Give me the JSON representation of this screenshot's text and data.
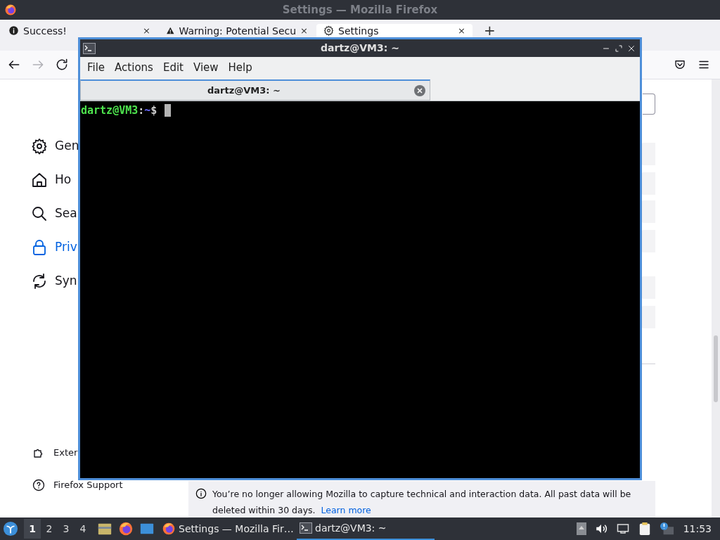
{
  "firefox": {
    "title": "Settings — Mozilla Firefox",
    "tabs": [
      {
        "label": "Success!",
        "close": "×",
        "selected": false
      },
      {
        "label": "Warning: Potential Secu",
        "close": "×",
        "selected": false
      },
      {
        "label": "Settings",
        "close": "×",
        "selected": true
      }
    ],
    "new_tab": "+",
    "nav_buttons": [
      {
        "kind": "back",
        "disabled": false
      },
      {
        "kind": "forward",
        "disabled": true
      },
      {
        "kind": "reload",
        "disabled": false
      }
    ],
    "sidebar": {
      "items": [
        {
          "label": "Gen",
          "selected": false
        },
        {
          "label": "Ho",
          "selected": false
        },
        {
          "label": "Sea",
          "selected": false
        },
        {
          "label": "Priv",
          "selected": true
        },
        {
          "label": "Syn",
          "selected": false
        }
      ],
      "footer": [
        {
          "label": "Exter"
        },
        {
          "label": "Firefox Support"
        }
      ]
    },
    "notification": {
      "text": "You’re no longer allowing Mozilla to capture technical and interaction data. All past data will be deleted within 30 days.",
      "link": "Learn more"
    }
  },
  "terminal": {
    "title": "dartz@VM3: ~",
    "menu": [
      "File",
      "Actions",
      "Edit",
      "View",
      "Help"
    ],
    "tab": "dartz@VM3: ~",
    "prompt": {
      "user_host": "dartz@VM3",
      "separator": ":",
      "path": "~",
      "symbol": "$"
    }
  },
  "taskbar": {
    "workspaces": [
      {
        "label": "1",
        "selected": true
      },
      {
        "label": "2",
        "selected": false
      },
      {
        "label": "3",
        "selected": false
      },
      {
        "label": "4",
        "selected": false
      }
    ],
    "tasks": [
      {
        "label": "Settings — Mozilla Fir…",
        "selected": false
      },
      {
        "label": "dartz@VM3: ~",
        "selected": true
      }
    ],
    "clock": "11:53"
  }
}
